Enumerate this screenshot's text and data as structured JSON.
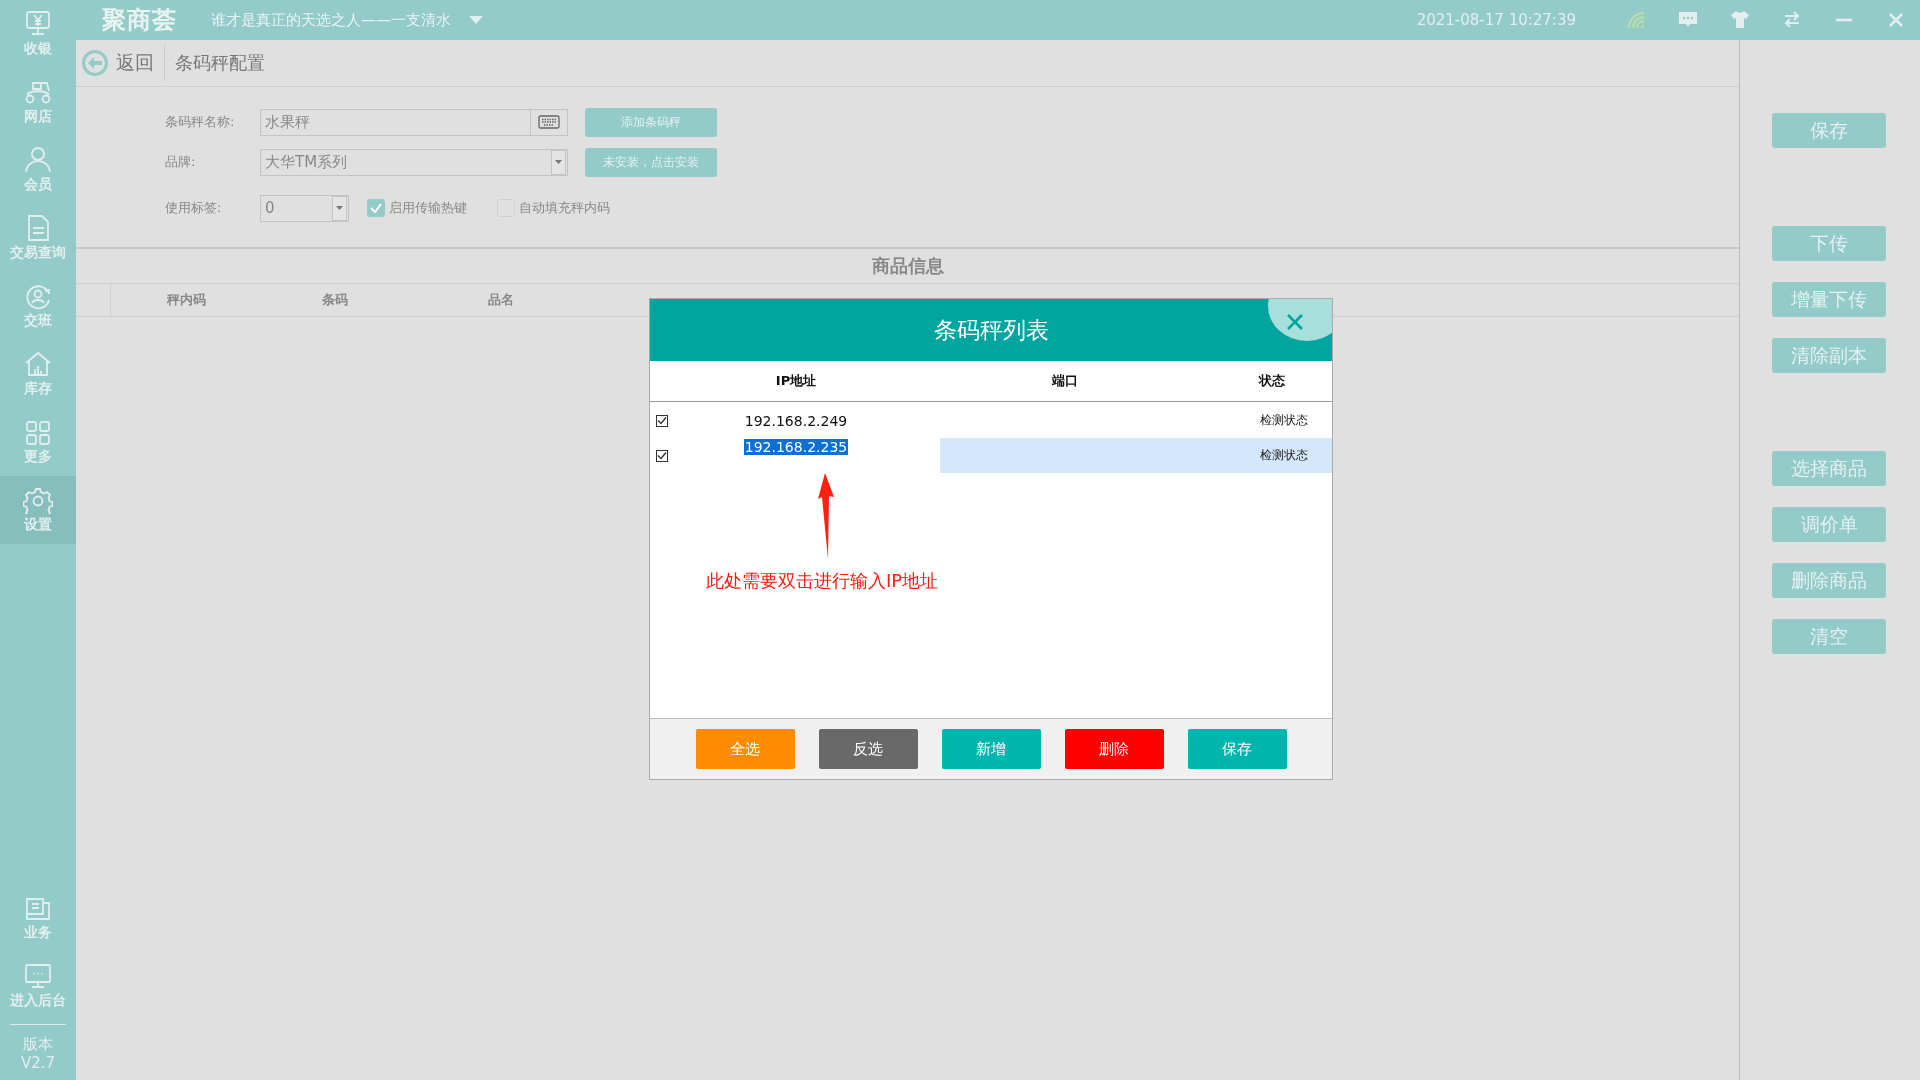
{
  "sidebar": {
    "items": [
      {
        "label": "收银",
        "selected": false
      },
      {
        "label": "网店",
        "selected": false
      },
      {
        "label": "会员",
        "selected": false
      },
      {
        "label": "交易查询",
        "selected": false
      },
      {
        "label": "交班",
        "selected": false
      },
      {
        "label": "库存",
        "selected": false
      },
      {
        "label": "更多",
        "selected": false
      },
      {
        "label": "设置",
        "selected": true
      }
    ],
    "bottom_items": [
      {
        "label": "业务",
        "selected": false
      },
      {
        "label": "进入后台",
        "selected": false
      }
    ],
    "version": {
      "label": "版本",
      "value": "V2.7"
    }
  },
  "top_bar": {
    "logo": "聚商荟",
    "slogan": "谁才是真正的天选之人——一支清水",
    "datetime": "2021-08-17 10:27:39"
  },
  "page_header": {
    "back": "返回",
    "title": "条码秤配置"
  },
  "form": {
    "name_label": "条码秤名称:",
    "name_value": "水果秤",
    "add_button": "添加条码秤",
    "brand_label": "品牌:",
    "brand_value": "大华TM系列",
    "install_button": "未安装，点击安装",
    "tag_label": "使用标签:",
    "tag_value": "0",
    "options": [
      {
        "label": "启用传输热键",
        "checked": true
      },
      {
        "label": "自动填充秤内码",
        "checked": false
      }
    ]
  },
  "product_table": {
    "title": "商品信息",
    "columns": [
      "秤内码",
      "条码",
      "品名"
    ]
  },
  "side_button_groups": [
    [
      "保存"
    ],
    [
      "下传",
      "增量下传",
      "清除副本"
    ],
    [
      "选择商品",
      "调价单",
      "删除商品",
      "清空"
    ]
  ],
  "dialog": {
    "title": "条码秤列表",
    "columns": [
      "IP地址",
      "端口",
      "状态"
    ],
    "rows": [
      {
        "checked": true,
        "selected": false,
        "ip": "192.168.2.249",
        "status": "检测状态"
      },
      {
        "checked": true,
        "selected": true,
        "ip": "192.168.2.235",
        "status": "检测状态"
      }
    ],
    "annotation": "此处需要双击进行输入IP地址",
    "buttons": [
      {
        "label": "全选",
        "color": "#ff8c00"
      },
      {
        "label": "反选",
        "color": "#696969"
      },
      {
        "label": "新增",
        "color": "#00b5ad"
      },
      {
        "label": "删除",
        "color": "#ff0000"
      },
      {
        "label": "保存",
        "color": "#00b5ad"
      }
    ]
  }
}
